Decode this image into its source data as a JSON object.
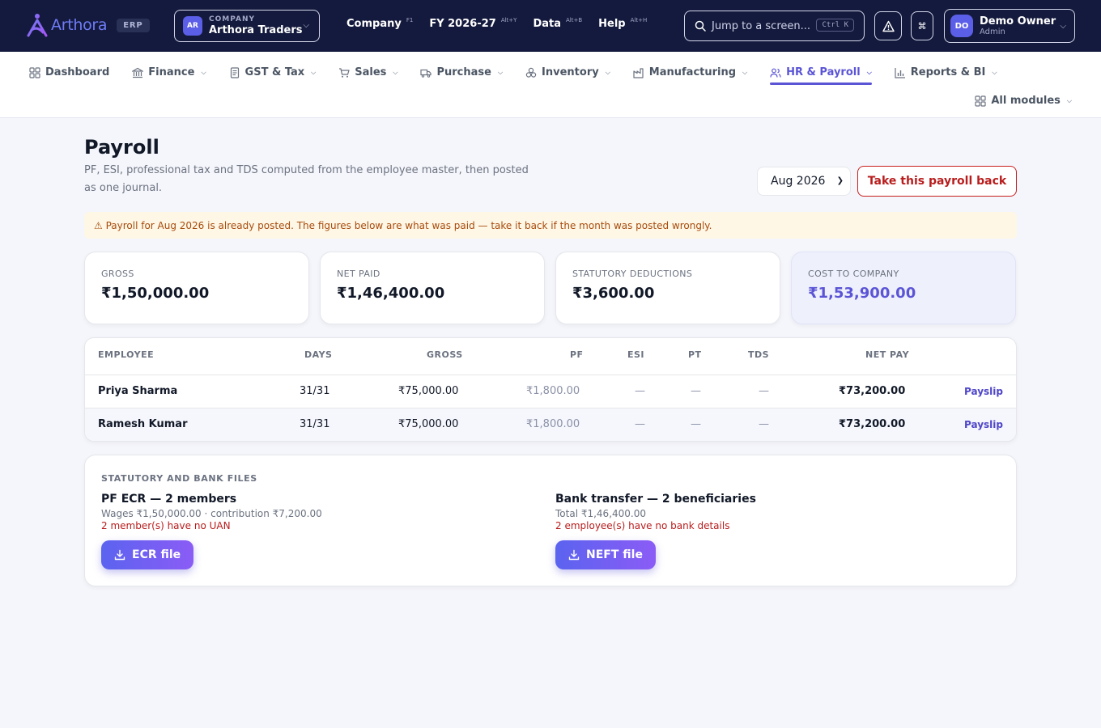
{
  "brand": {
    "name": "Arthora",
    "badge": "ERP"
  },
  "company": {
    "initials": "AR",
    "caption": "COMPANY",
    "name": "Arthora Traders"
  },
  "top_menu": [
    {
      "label": "Company",
      "shortcut": "F1"
    },
    {
      "label": "FY 2026-27",
      "shortcut": "Alt+Y"
    },
    {
      "label": "Data",
      "shortcut": "Alt+B"
    },
    {
      "label": "Help",
      "shortcut": "Alt+H"
    }
  ],
  "search": {
    "placeholder": "Jump to a screen...",
    "shortcut": "Ctrl K"
  },
  "user": {
    "initials": "DO",
    "name": "Demo Owner",
    "role": "Admin"
  },
  "modules": [
    {
      "label": "Dashboard",
      "icon": "grid-icon"
    },
    {
      "label": "Finance",
      "icon": "bank-icon"
    },
    {
      "label": "GST & Tax",
      "icon": "document-icon"
    },
    {
      "label": "Sales",
      "icon": "cart-icon"
    },
    {
      "label": "Purchase",
      "icon": "truck-icon"
    },
    {
      "label": "Inventory",
      "icon": "boxes-icon"
    },
    {
      "label": "Manufacturing",
      "icon": "factory-icon"
    },
    {
      "label": "HR & Payroll",
      "icon": "users-icon",
      "active": true
    },
    {
      "label": "Reports & BI",
      "icon": "bar-chart-icon"
    }
  ],
  "all_modules_label": "All modules",
  "page": {
    "title": "Payroll",
    "subtitle": "PF, ESI, professional tax and TDS computed from the employee master, then posted as one journal.",
    "month": "Aug 2026",
    "take_back_label": "Take this payroll back",
    "alert": "⚠ Payroll for Aug 2026 is already posted. The figures below are what was paid — take it back if the month was posted wrongly."
  },
  "stats": [
    {
      "label": "GROSS",
      "value": "₹1,50,000.00"
    },
    {
      "label": "NET PAID",
      "value": "₹1,46,400.00"
    },
    {
      "label": "STATUTORY DEDUCTIONS",
      "value": "₹3,600.00"
    },
    {
      "label": "COST TO COMPANY",
      "value": "₹1,53,900.00"
    }
  ],
  "table": {
    "headers": [
      "EMPLOYEE",
      "DAYS",
      "GROSS",
      "PF",
      "ESI",
      "PT",
      "TDS",
      "NET PAY"
    ],
    "rows": [
      {
        "employee": "Priya Sharma",
        "days": "31/31",
        "gross": "₹75,000.00",
        "pf": "₹1,800.00",
        "esi": "—",
        "pt": "—",
        "tds": "—",
        "net": "₹73,200.00",
        "action": "Payslip"
      },
      {
        "employee": "Ramesh Kumar",
        "days": "31/31",
        "gross": "₹75,000.00",
        "pf": "₹1,800.00",
        "esi": "—",
        "pt": "—",
        "tds": "—",
        "net": "₹73,200.00",
        "action": "Payslip"
      }
    ]
  },
  "files": {
    "title": "STATUTORY AND BANK FILES",
    "pf": {
      "heading": "PF ECR — 2 members",
      "detail": "Wages ₹1,50,000.00 · contribution ₹7,200.00",
      "warning": "2 member(s) have no UAN",
      "button": "ECR file"
    },
    "bank": {
      "heading": "Bank transfer — 2 beneficiaries",
      "detail": "Total ₹1,46,400.00",
      "warning": "2 employee(s) have no bank details",
      "button": "NEFT file"
    }
  },
  "colors": {
    "topbar": "#141a3d",
    "accent": "#5b55d6",
    "danger": "#b91c1c",
    "alert_bg": "#fef7e6"
  }
}
